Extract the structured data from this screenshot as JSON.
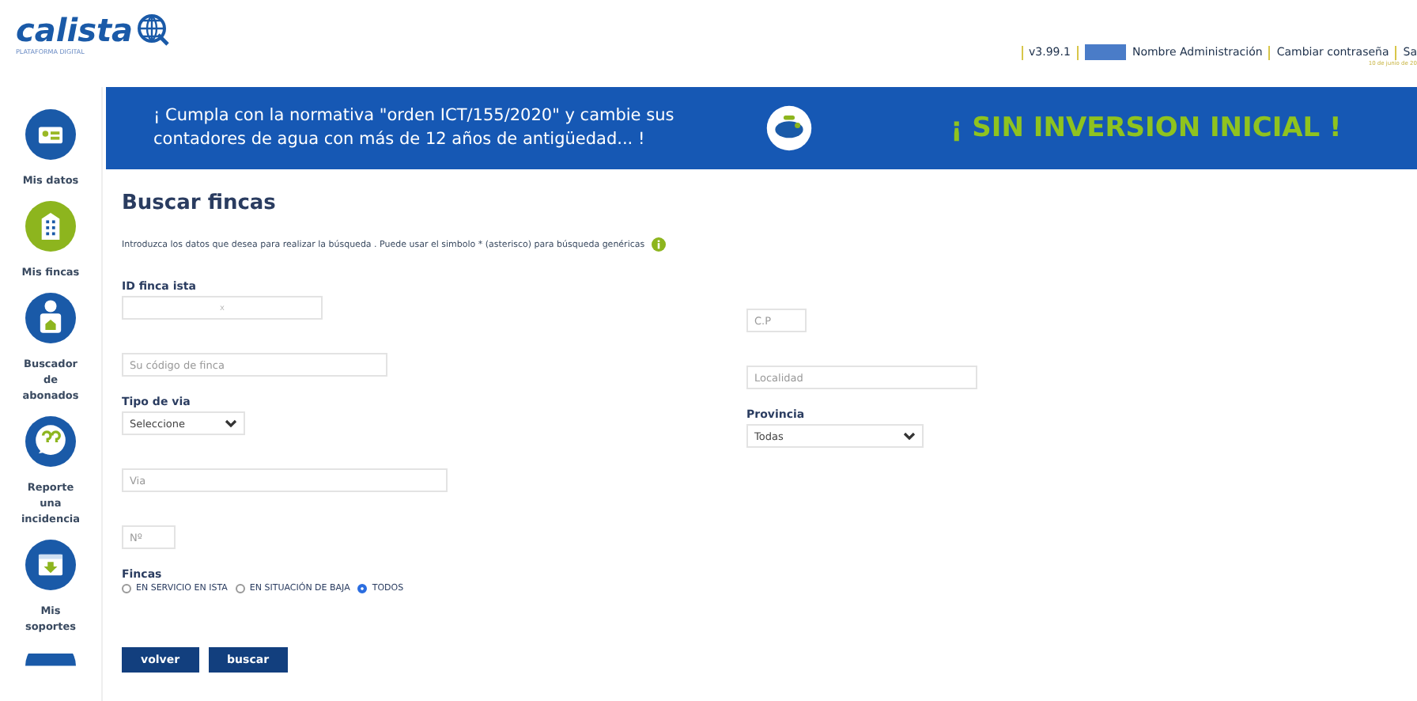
{
  "logo": {
    "name": "calista",
    "subtitle": "PLATAFORMA DIGITAL"
  },
  "top_bar": {
    "version": "v3.99.1",
    "user": "Nombre Administración",
    "change_password": "Cambiar contraseña",
    "logout_cut": "Sa",
    "date": "10 de junio de 20"
  },
  "sidebar": {
    "items": [
      {
        "label": "Mis datos",
        "kind": "card"
      },
      {
        "label": "Mis fincas",
        "kind": "building"
      },
      {
        "label": "Buscador de abonados",
        "kind": "person"
      },
      {
        "label": "Reporte una incidencia",
        "kind": "question"
      },
      {
        "label": "Mis soportes",
        "kind": "download"
      },
      {
        "kind": "partial"
      }
    ]
  },
  "banner": {
    "message": "¡ Cumpla con la normativa \"orden ICT/155/2020\" y cambie sus contadores de agua con más de 12 años de antigüedad... !",
    "slogan": "¡ SIN INVERSION INICIAL !"
  },
  "form": {
    "title": "Buscar fincas",
    "hint": "Introduzca los datos que desea para realizar la búsqueda .  Puede usar el simbolo * (asterisco) para búsqueda genéricas",
    "id_label": "ID finca ista",
    "id_separator": "x",
    "code_placeholder": "Su código de finca",
    "cp_placeholder": "C.P",
    "locality_placeholder": "Localidad",
    "street_type_label": "Tipo de via",
    "street_type_value": "Seleccione",
    "province_label": "Provincia",
    "province_value": "Todas",
    "street_placeholder": "Via",
    "number_placeholder": "Nº",
    "fincas_label": "Fincas",
    "fincas_options": [
      {
        "label": "EN SERVICIO EN ISTA",
        "selected": false
      },
      {
        "label": "EN SITUACIÓN DE BAJA",
        "selected": false
      },
      {
        "label": "TODOS",
        "selected": true
      }
    ],
    "buttons": [
      "volver",
      "buscar"
    ]
  }
}
